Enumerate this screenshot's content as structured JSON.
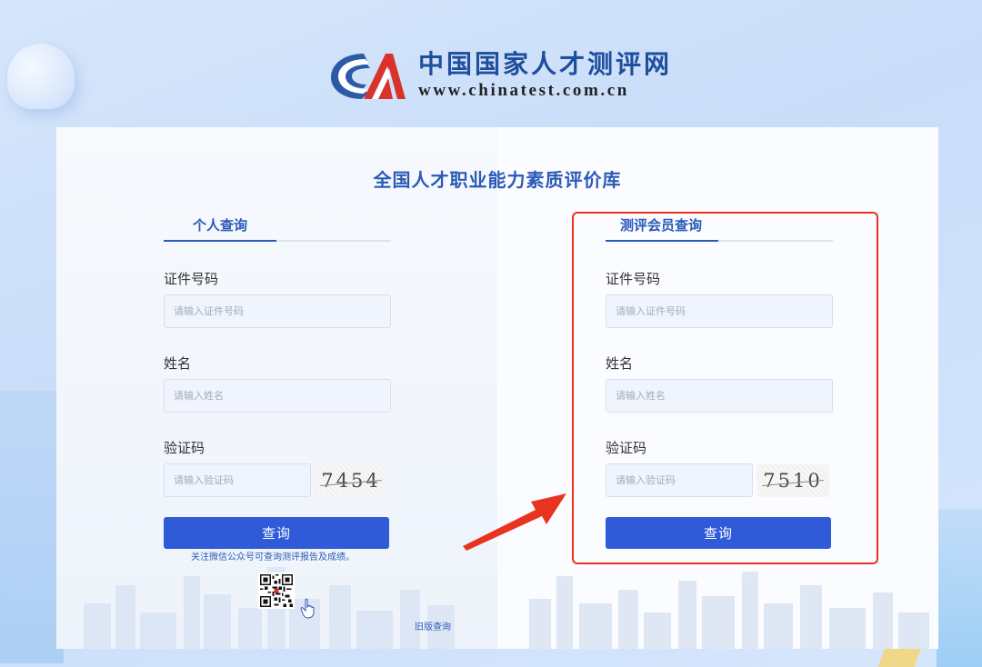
{
  "header": {
    "site_name": "中国国家人才测评网",
    "site_url": "www.chinatest.com.cn"
  },
  "main": {
    "title": "全国人才职业能力素质评价库"
  },
  "personal_panel": {
    "tab_label": "个人查询",
    "id_label": "证件号码",
    "id_placeholder": "请输入证件号码",
    "name_label": "姓名",
    "name_placeholder": "请输入姓名",
    "captcha_label": "验证码",
    "captcha_placeholder": "请输入验证码",
    "captcha_code": "7454",
    "submit_label": "查询"
  },
  "member_panel": {
    "tab_label": "测评会员查询",
    "id_label": "证件号码",
    "id_placeholder": "请输入证件号码",
    "name_label": "姓名",
    "name_placeholder": "请输入姓名",
    "captcha_label": "验证码",
    "captcha_placeholder": "请输入验证码",
    "captcha_code": "7510",
    "submit_label": "查询"
  },
  "footer": {
    "follow_text": "关注微信公众号可查询测评报告及成绩。",
    "old_version_link": "旧版查询"
  },
  "icons": {
    "logo": "ca-logo-icon",
    "qr_code": "qr-code-icon",
    "pointer": "hand-pointer-icon",
    "annotation_arrow": "red-arrow-icon"
  },
  "colors": {
    "brand_blue": "#2a5ab8",
    "button_blue": "#2f5bd8",
    "annotation_red": "#e8341f"
  }
}
